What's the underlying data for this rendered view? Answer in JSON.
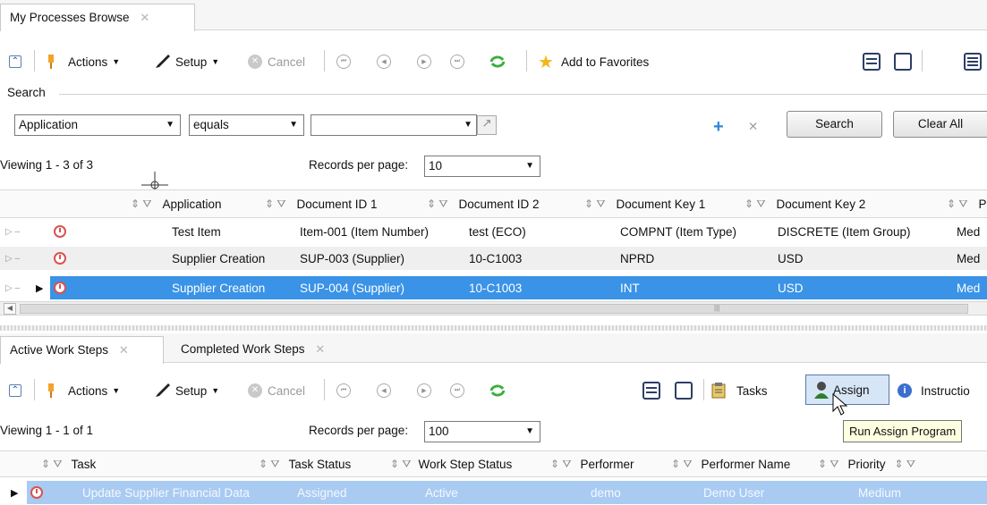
{
  "top_tab": {
    "label": "My Processes Browse",
    "close": "✕"
  },
  "toolbar1": {
    "actions": "Actions",
    "setup": "Setup",
    "cancel": "Cancel",
    "favorites": "Add to Favorites"
  },
  "search": {
    "section_label": "Search",
    "field": "Application",
    "operator": "equals",
    "value": "",
    "add": "+",
    "remove": "✕",
    "search_btn": "Search",
    "clear_btn": "Clear All"
  },
  "grid1": {
    "viewing": "Viewing 1 - 3 of 3",
    "records_label": "Records per page:",
    "records_value": "10",
    "columns": [
      "Application",
      "Document ID 1",
      "Document ID 2",
      "Document Key 1",
      "Document Key 2",
      "Pric"
    ],
    "rows": [
      [
        "Test Item",
        "Item-001 (Item Number)",
        "test (ECO)",
        "COMPNT (Item Type)",
        "DISCRETE (Item Group)",
        "Med"
      ],
      [
        "Supplier Creation",
        "SUP-003 (Supplier)",
        "10-C1003",
        "NPRD",
        "USD",
        "Med"
      ],
      [
        "Supplier Creation",
        "SUP-004 (Supplier)",
        "10-C1003",
        "INT",
        "USD",
        "Med"
      ]
    ],
    "selected_row": 2
  },
  "bottom_tabs": [
    {
      "label": "Active Work Steps",
      "close": "✕"
    },
    {
      "label": "Completed Work Steps",
      "close": "✕"
    }
  ],
  "toolbar2": {
    "actions": "Actions",
    "setup": "Setup",
    "cancel": "Cancel",
    "tasks": "Tasks",
    "assign": "Assign",
    "instructions": "Instructio"
  },
  "tooltip": "Run Assign Program",
  "grid2": {
    "viewing": "Viewing 1 - 1 of 1",
    "records_label": "Records per page:",
    "records_value": "100",
    "columns": [
      "Task",
      "Task Status",
      "Work Step Status",
      "Performer",
      "Performer Name",
      "Priority"
    ],
    "rows": [
      [
        "Update Supplier Financial Data",
        "Assigned",
        "Active",
        "demo",
        "Demo User",
        "Medium"
      ]
    ]
  },
  "colors": {
    "selection": "#3a93e6",
    "selection_light": "#a9cbf2",
    "alarm": "#d9534f",
    "accent_blue": "#2b88d8"
  }
}
